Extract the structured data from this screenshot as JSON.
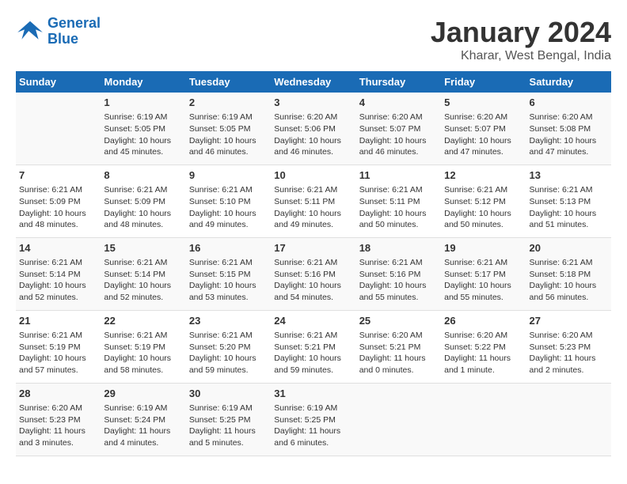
{
  "header": {
    "logo_line1": "General",
    "logo_line2": "Blue",
    "title": "January 2024",
    "subtitle": "Kharar, West Bengal, India"
  },
  "calendar": {
    "days_of_week": [
      "Sunday",
      "Monday",
      "Tuesday",
      "Wednesday",
      "Thursday",
      "Friday",
      "Saturday"
    ],
    "weeks": [
      [
        {
          "day": "",
          "sunrise": "",
          "sunset": "",
          "daylight": ""
        },
        {
          "day": "1",
          "sunrise": "Sunrise: 6:19 AM",
          "sunset": "Sunset: 5:05 PM",
          "daylight": "Daylight: 10 hours and 45 minutes."
        },
        {
          "day": "2",
          "sunrise": "Sunrise: 6:19 AM",
          "sunset": "Sunset: 5:05 PM",
          "daylight": "Daylight: 10 hours and 46 minutes."
        },
        {
          "day": "3",
          "sunrise": "Sunrise: 6:20 AM",
          "sunset": "Sunset: 5:06 PM",
          "daylight": "Daylight: 10 hours and 46 minutes."
        },
        {
          "day": "4",
          "sunrise": "Sunrise: 6:20 AM",
          "sunset": "Sunset: 5:07 PM",
          "daylight": "Daylight: 10 hours and 46 minutes."
        },
        {
          "day": "5",
          "sunrise": "Sunrise: 6:20 AM",
          "sunset": "Sunset: 5:07 PM",
          "daylight": "Daylight: 10 hours and 47 minutes."
        },
        {
          "day": "6",
          "sunrise": "Sunrise: 6:20 AM",
          "sunset": "Sunset: 5:08 PM",
          "daylight": "Daylight: 10 hours and 47 minutes."
        }
      ],
      [
        {
          "day": "7",
          "sunrise": "Sunrise: 6:21 AM",
          "sunset": "Sunset: 5:09 PM",
          "daylight": "Daylight: 10 hours and 48 minutes."
        },
        {
          "day": "8",
          "sunrise": "Sunrise: 6:21 AM",
          "sunset": "Sunset: 5:09 PM",
          "daylight": "Daylight: 10 hours and 48 minutes."
        },
        {
          "day": "9",
          "sunrise": "Sunrise: 6:21 AM",
          "sunset": "Sunset: 5:10 PM",
          "daylight": "Daylight: 10 hours and 49 minutes."
        },
        {
          "day": "10",
          "sunrise": "Sunrise: 6:21 AM",
          "sunset": "Sunset: 5:11 PM",
          "daylight": "Daylight: 10 hours and 49 minutes."
        },
        {
          "day": "11",
          "sunrise": "Sunrise: 6:21 AM",
          "sunset": "Sunset: 5:11 PM",
          "daylight": "Daylight: 10 hours and 50 minutes."
        },
        {
          "day": "12",
          "sunrise": "Sunrise: 6:21 AM",
          "sunset": "Sunset: 5:12 PM",
          "daylight": "Daylight: 10 hours and 50 minutes."
        },
        {
          "day": "13",
          "sunrise": "Sunrise: 6:21 AM",
          "sunset": "Sunset: 5:13 PM",
          "daylight": "Daylight: 10 hours and 51 minutes."
        }
      ],
      [
        {
          "day": "14",
          "sunrise": "Sunrise: 6:21 AM",
          "sunset": "Sunset: 5:14 PM",
          "daylight": "Daylight: 10 hours and 52 minutes."
        },
        {
          "day": "15",
          "sunrise": "Sunrise: 6:21 AM",
          "sunset": "Sunset: 5:14 PM",
          "daylight": "Daylight: 10 hours and 52 minutes."
        },
        {
          "day": "16",
          "sunrise": "Sunrise: 6:21 AM",
          "sunset": "Sunset: 5:15 PM",
          "daylight": "Daylight: 10 hours and 53 minutes."
        },
        {
          "day": "17",
          "sunrise": "Sunrise: 6:21 AM",
          "sunset": "Sunset: 5:16 PM",
          "daylight": "Daylight: 10 hours and 54 minutes."
        },
        {
          "day": "18",
          "sunrise": "Sunrise: 6:21 AM",
          "sunset": "Sunset: 5:16 PM",
          "daylight": "Daylight: 10 hours and 55 minutes."
        },
        {
          "day": "19",
          "sunrise": "Sunrise: 6:21 AM",
          "sunset": "Sunset: 5:17 PM",
          "daylight": "Daylight: 10 hours and 55 minutes."
        },
        {
          "day": "20",
          "sunrise": "Sunrise: 6:21 AM",
          "sunset": "Sunset: 5:18 PM",
          "daylight": "Daylight: 10 hours and 56 minutes."
        }
      ],
      [
        {
          "day": "21",
          "sunrise": "Sunrise: 6:21 AM",
          "sunset": "Sunset: 5:19 PM",
          "daylight": "Daylight: 10 hours and 57 minutes."
        },
        {
          "day": "22",
          "sunrise": "Sunrise: 6:21 AM",
          "sunset": "Sunset: 5:19 PM",
          "daylight": "Daylight: 10 hours and 58 minutes."
        },
        {
          "day": "23",
          "sunrise": "Sunrise: 6:21 AM",
          "sunset": "Sunset: 5:20 PM",
          "daylight": "Daylight: 10 hours and 59 minutes."
        },
        {
          "day": "24",
          "sunrise": "Sunrise: 6:21 AM",
          "sunset": "Sunset: 5:21 PM",
          "daylight": "Daylight: 10 hours and 59 minutes."
        },
        {
          "day": "25",
          "sunrise": "Sunrise: 6:20 AM",
          "sunset": "Sunset: 5:21 PM",
          "daylight": "Daylight: 11 hours and 0 minutes."
        },
        {
          "day": "26",
          "sunrise": "Sunrise: 6:20 AM",
          "sunset": "Sunset: 5:22 PM",
          "daylight": "Daylight: 11 hours and 1 minute."
        },
        {
          "day": "27",
          "sunrise": "Sunrise: 6:20 AM",
          "sunset": "Sunset: 5:23 PM",
          "daylight": "Daylight: 11 hours and 2 minutes."
        }
      ],
      [
        {
          "day": "28",
          "sunrise": "Sunrise: 6:20 AM",
          "sunset": "Sunset: 5:23 PM",
          "daylight": "Daylight: 11 hours and 3 minutes."
        },
        {
          "day": "29",
          "sunrise": "Sunrise: 6:19 AM",
          "sunset": "Sunset: 5:24 PM",
          "daylight": "Daylight: 11 hours and 4 minutes."
        },
        {
          "day": "30",
          "sunrise": "Sunrise: 6:19 AM",
          "sunset": "Sunset: 5:25 PM",
          "daylight": "Daylight: 11 hours and 5 minutes."
        },
        {
          "day": "31",
          "sunrise": "Sunrise: 6:19 AM",
          "sunset": "Sunset: 5:25 PM",
          "daylight": "Daylight: 11 hours and 6 minutes."
        },
        {
          "day": "",
          "sunrise": "",
          "sunset": "",
          "daylight": ""
        },
        {
          "day": "",
          "sunrise": "",
          "sunset": "",
          "daylight": ""
        },
        {
          "day": "",
          "sunrise": "",
          "sunset": "",
          "daylight": ""
        }
      ]
    ]
  }
}
